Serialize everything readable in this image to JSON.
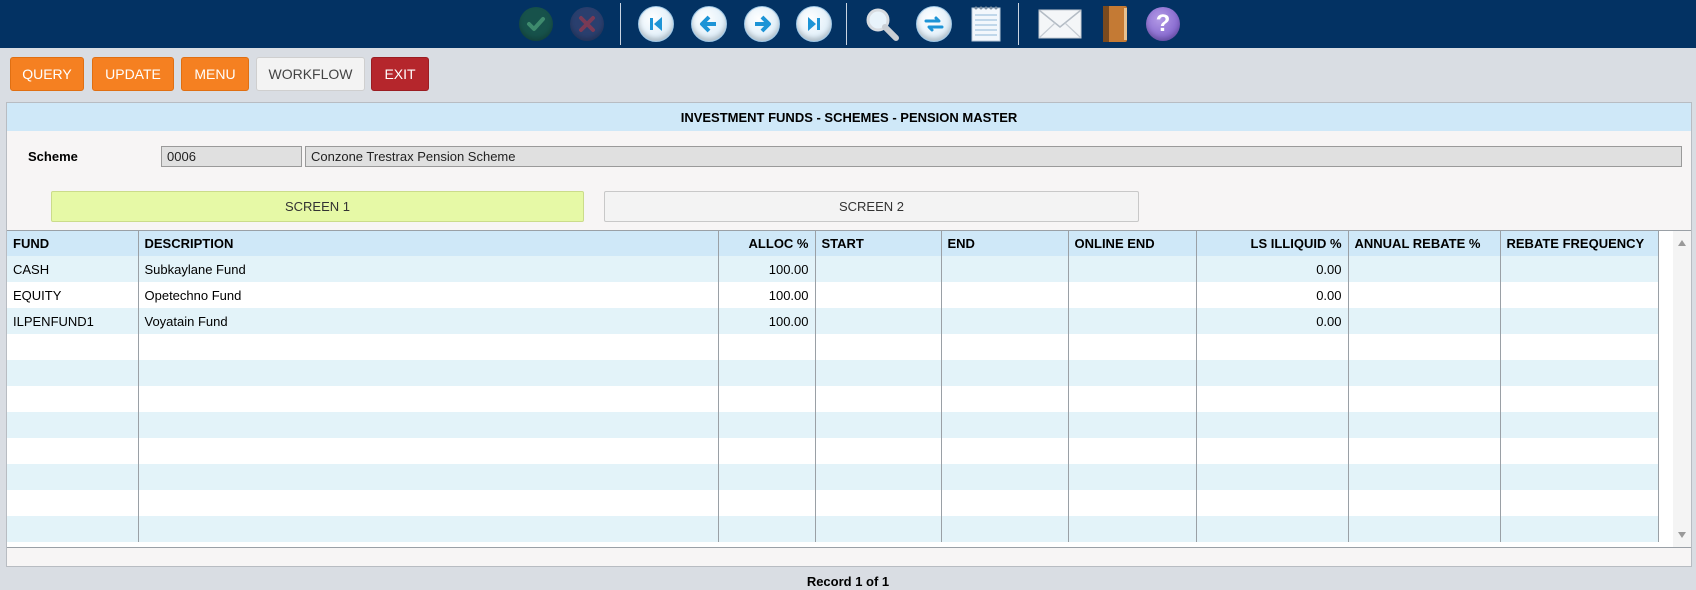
{
  "toolbar": {
    "icons": [
      "check-icon",
      "cancel-icon",
      "first-record-icon",
      "previous-record-icon",
      "next-record-icon",
      "last-record-icon",
      "search-icon",
      "refresh-icon",
      "notepad-icon",
      "mail-icon",
      "book-icon",
      "help-icon"
    ],
    "help_glyph": "?"
  },
  "actions": {
    "query": "QUERY",
    "update": "UPDATE",
    "menu": "MENU",
    "workflow": "WORKFLOW",
    "exit": "EXIT"
  },
  "panel": {
    "title": "INVESTMENT FUNDS - SCHEMES - PENSION MASTER",
    "scheme_label": "Scheme",
    "scheme_code": "0006",
    "scheme_name": "Conzone Trestrax Pension Scheme",
    "tabs": [
      "SCREEN 1",
      "SCREEN 2"
    ]
  },
  "grid": {
    "columns": [
      "FUND",
      "DESCRIPTION",
      "ALLOC %",
      "START",
      "END",
      "ONLINE END",
      "LS ILLIQUID %",
      "ANNUAL REBATE %",
      "REBATE FREQUENCY"
    ],
    "rows": [
      {
        "fund": "CASH",
        "description": "Subkaylane Fund",
        "alloc": "100.00",
        "start": "",
        "end": "",
        "online_end": "",
        "ls_illiquid": "0.00",
        "annual_rebate": "",
        "rebate_frequency": ""
      },
      {
        "fund": "EQUITY",
        "description": "Opetechno Fund",
        "alloc": "100.00",
        "start": "",
        "end": "",
        "online_end": "",
        "ls_illiquid": "0.00",
        "annual_rebate": "",
        "rebate_frequency": ""
      },
      {
        "fund": "ILPENFUND1",
        "description": "Voyatain Fund",
        "alloc": "100.00",
        "start": "",
        "end": "",
        "online_end": "",
        "ls_illiquid": "0.00",
        "annual_rebate": "",
        "rebate_frequency": ""
      }
    ],
    "empty_rows": 8
  },
  "status": {
    "record": "Record 1 of 1"
  },
  "colors": {
    "topbar": "#033263",
    "orange": "#f58021",
    "exit_red": "#b5262c",
    "active_tab": "#e6f9a6",
    "header_blue": "#cfe8f8"
  }
}
